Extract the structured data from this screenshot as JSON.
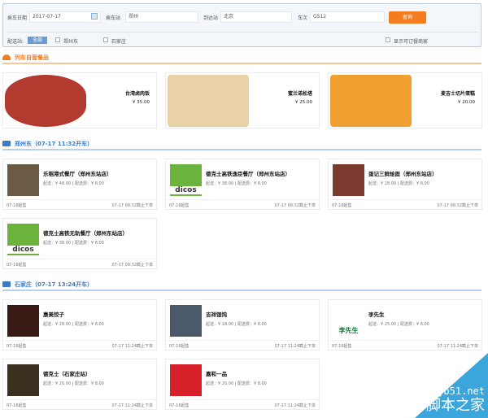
{
  "search": {
    "date_label": "乘车日期",
    "date_value": "2017-07-17",
    "from_label": "乘车站",
    "from_value": "郑州",
    "to_label": "到达站",
    "to_value": "北京",
    "train_label": "车次",
    "train_value": "G512",
    "query_button": "查询",
    "station_label": "配送站:",
    "station_all": "全部",
    "station_options": [
      "郑州东",
      "石家庄"
    ],
    "show_available": "显示可订餐商家"
  },
  "sections": [
    {
      "title": "列车自营餐品",
      "color": "#f47b1e",
      "products": [
        {
          "name": "台湾卤肉饭",
          "price": "¥ 35.00",
          "color": "#b33a2e"
        },
        {
          "name": "蜜兰诺松塔",
          "price": "¥ 25.00",
          "color": "#e9d2a8"
        },
        {
          "name": "麦吉士切片蛋糕",
          "price": "¥ 20.00",
          "color": "#f0a030"
        }
      ]
    },
    {
      "title": "郑州东（07-17 11:32开车）",
      "color": "#3a7bc8",
      "restaurants": [
        {
          "name": "乐稻港式餐厅（郑州东站店）",
          "fee": "起送：¥ 48.00 | 配送费：¥ 8.00",
          "start": "07-16起售",
          "deadline": "07-17 09:32截止下单",
          "color": "#6b5a44"
        },
        {
          "name": "德克士高铁逸臣餐厅（郑州东站店）",
          "fee": "起送：¥ 38.00 | 配送费：¥ 8.00",
          "start": "07-16起售",
          "deadline": "07-17 09:32截止下单",
          "color": "#6cb33e",
          "logo": "dicos"
        },
        {
          "name": "蛋记三鲜烩面（郑州东站店）",
          "fee": "起送：¥ 28.00 | 配送费：¥ 8.00",
          "start": "07-16起售",
          "deadline": "07-17 09:32截止下单",
          "color": "#7a3a30"
        },
        {
          "name": "德克士高铁无轨餐厅（郑州东站店）",
          "fee": "起送：¥ 38.00 | 配送费：¥ 8.00",
          "start": "07-16起售",
          "deadline": "07-17 09:32截止下单",
          "color": "#6cb33e",
          "logo": "dicos"
        }
      ]
    },
    {
      "title": "石家庄（07-17 13:24开车）",
      "color": "#3a7bc8",
      "restaurants": [
        {
          "name": "惠美饺子",
          "fee": "起送：¥ 28.00 | 配送费：¥ 8.00",
          "start": "07-16起售",
          "deadline": "07-17 11:24截止下单",
          "color": "#3a1a14"
        },
        {
          "name": "吉祥馄饨",
          "fee": "起送：¥ 18.00 | 配送费：¥ 8.00",
          "start": "07-16起售",
          "deadline": "07-17 11:24截止下单",
          "color": "#4a5a6a"
        },
        {
          "name": "李先生",
          "fee": "起送：¥ 25.00 | 配送费：¥ 8.00",
          "start": "07-16起售",
          "deadline": "07-17 11:24截止下单",
          "color": "#ffffff",
          "logo": "李先生"
        },
        {
          "name": "德克士（石家庄站）",
          "fee": "起送：¥ 20.00 | 配送费：¥ 8.00",
          "start": "07-16起售",
          "deadline": "07-17 11:24截止下单",
          "color": "#3a3020"
        },
        {
          "name": "嘉和一品",
          "fee": "起送：¥ 20.00 | 配送费：¥ 8.00",
          "start": "07-16起售",
          "deadline": "07-17 11:24截止下单",
          "color": "#d8202a"
        }
      ]
    }
  ],
  "watermark": {
    "site": "jb51.net",
    "name": "脚本之家"
  }
}
